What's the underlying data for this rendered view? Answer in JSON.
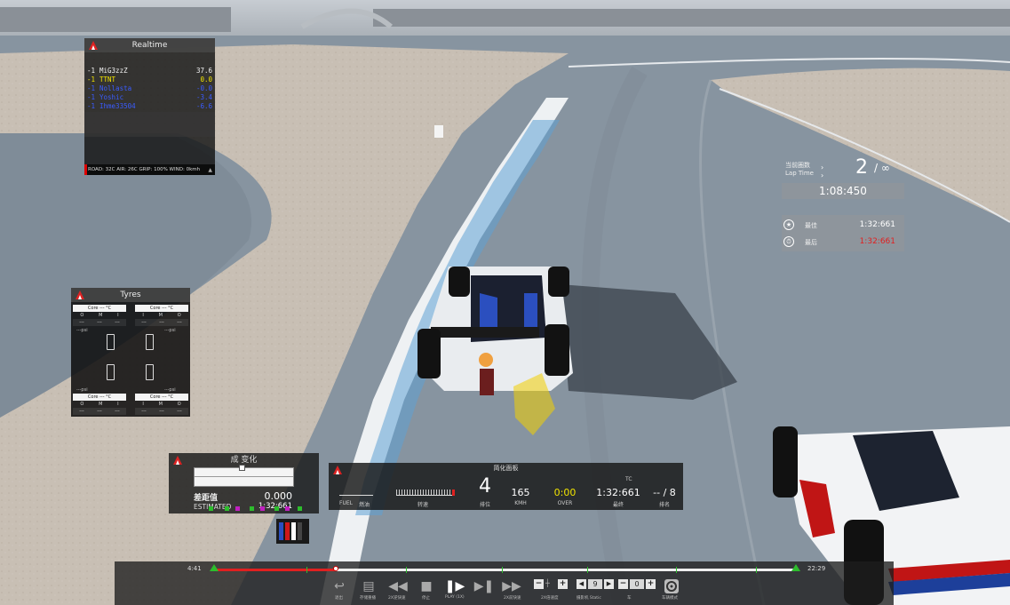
{
  "realtime": {
    "title": "Realtime",
    "rows": [
      {
        "pos": "-1",
        "name": "MiG3zzZ",
        "gap": "37.6",
        "color": "white"
      },
      {
        "pos": "-1",
        "name": "TTNT",
        "gap": "0.0",
        "color": "yellow"
      },
      {
        "pos": "-1",
        "name": "Nollasta",
        "gap": "-0.0",
        "color": "blue"
      },
      {
        "pos": "-1",
        "name": "Yoshic",
        "gap": "-3.4",
        "color": "blue"
      },
      {
        "pos": "-1",
        "name": "Ihme33504",
        "gap": "-6.6",
        "color": "blue"
      }
    ],
    "status": "ROAD: 32C AIR: 26C GRIP: 100% WIND: 0kmh"
  },
  "tyres": {
    "title": "Tyres",
    "core_label": "Core --- °C",
    "omi": [
      "O",
      "M",
      "I",
      "I",
      "M",
      "O"
    ],
    "dash": "---",
    "psi": "---psi"
  },
  "delta": {
    "title": "成   变化",
    "label": "差距值",
    "value": "0.000",
    "estimated_label": "ESTIMATED",
    "estimated_value": "1:32:661"
  },
  "dashboard": {
    "title": "简化面板",
    "fuel_label": "FUEL",
    "fuel_cn": "燃油",
    "rpm_label": "转速",
    "position": "4",
    "position_label": "排位",
    "speed": "165",
    "speed_unit": "KMH",
    "over": "0:00",
    "over_label": "OVER",
    "tc": "TC",
    "last_lap": "1:32:661",
    "last_label": "最终",
    "rank": "-- / 8",
    "rank_label": "排名"
  },
  "lap": {
    "current_lap_cn": "当前圈数",
    "lap_time_label": "Lap Time",
    "lap_number": "2",
    "lap_total": "/ ∞",
    "current_time": "1:08:450",
    "best_label": "最佳",
    "best_time": "1:32:661",
    "last_label": "最后",
    "last_time": "1:32:661",
    "best_color": "#ffffff",
    "last_color": "#e02020"
  },
  "replay": {
    "time_start": "4:41",
    "time_end": "22:29",
    "progress": 0.21,
    "labels": {
      "exit": "退出",
      "save": "存储重播",
      "rewind": "2X逆快速",
      "stop": "停止",
      "play": "PLAY (1X)",
      "step": "",
      "forward": "2X前快速",
      "speed": "2X倍速度",
      "camera": "摄影机 Static",
      "car": "车",
      "cockpit": "车辆模式"
    },
    "speed_value": "9",
    "car_value": "0"
  },
  "colors": {
    "accent_red": "#e02020",
    "timeline_green": "#2dbd2d",
    "driver_yellow": "#f2e400",
    "driver_blue": "#3a5cff"
  }
}
